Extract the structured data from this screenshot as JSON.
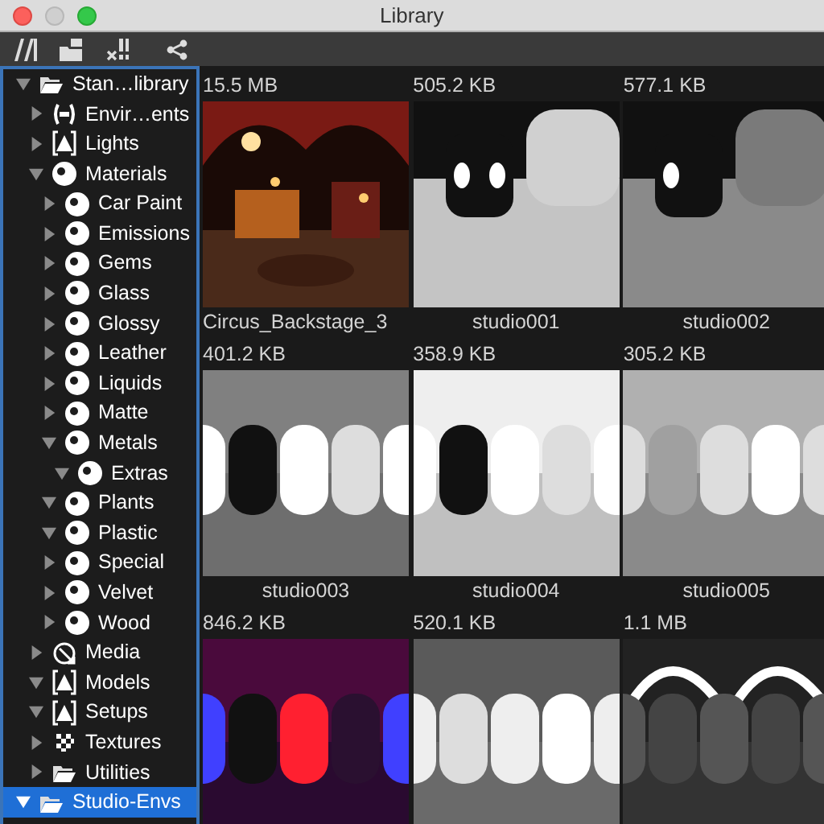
{
  "window": {
    "title": "Library"
  },
  "tree": [
    {
      "label": "Stan…library",
      "kind": "folder",
      "expanded": true,
      "selected": false,
      "children": [
        {
          "label": "Envir…ents",
          "kind": "environment",
          "expanded": false,
          "selected": false
        },
        {
          "label": "Lights",
          "kind": "light",
          "expanded": false,
          "selected": false
        },
        {
          "label": "Materials",
          "kind": "material",
          "expanded": true,
          "selected": false,
          "children": [
            {
              "label": "Car Paint",
              "kind": "material",
              "expanded": false,
              "selected": false
            },
            {
              "label": "Emissions",
              "kind": "material",
              "expanded": false,
              "selected": false
            },
            {
              "label": "Gems",
              "kind": "material",
              "expanded": false,
              "selected": false
            },
            {
              "label": "Glass",
              "kind": "material",
              "expanded": false,
              "selected": false
            },
            {
              "label": "Glossy",
              "kind": "material",
              "expanded": false,
              "selected": false
            },
            {
              "label": "Leather",
              "kind": "material",
              "expanded": false,
              "selected": false
            },
            {
              "label": "Liquids",
              "kind": "material",
              "expanded": false,
              "selected": false
            },
            {
              "label": "Matte",
              "kind": "material",
              "expanded": false,
              "selected": false
            },
            {
              "label": "Metals",
              "kind": "material",
              "expanded": true,
              "selected": false,
              "children": [
                {
                  "label": "Extras",
                  "kind": "material",
                  "expanded": true,
                  "selected": false
                }
              ]
            },
            {
              "label": "Plants",
              "kind": "material",
              "expanded": true,
              "selected": false
            },
            {
              "label": "Plastic",
              "kind": "material",
              "expanded": true,
              "selected": false
            },
            {
              "label": "Special",
              "kind": "material",
              "expanded": false,
              "selected": false
            },
            {
              "label": "Velvet",
              "kind": "material",
              "expanded": false,
              "selected": false
            },
            {
              "label": "Wood",
              "kind": "material",
              "expanded": false,
              "selected": false
            }
          ]
        },
        {
          "label": "Media",
          "kind": "media",
          "expanded": false,
          "selected": false
        },
        {
          "label": "Models",
          "kind": "light",
          "expanded": true,
          "selected": false
        },
        {
          "label": "Setups",
          "kind": "light",
          "expanded": true,
          "selected": false
        },
        {
          "label": "Textures",
          "kind": "texture",
          "expanded": false,
          "selected": false
        },
        {
          "label": "Utilities",
          "kind": "folder",
          "expanded": false,
          "selected": false
        }
      ]
    },
    {
      "label": "Studio-Envs",
      "kind": "folder",
      "expanded": true,
      "selected": true
    }
  ],
  "items": [
    {
      "size": "15.5 MB",
      "name": "Circus_Backstage_3",
      "kind": "picture"
    },
    {
      "size": "505.2 KB",
      "name": "studio001",
      "kind": "picture"
    },
    {
      "size": "577.1 KB",
      "name": "studio002",
      "kind": "picture"
    },
    {
      "size": "401.2 KB",
      "name": "studio003",
      "kind": "picture"
    },
    {
      "size": "358.9 KB",
      "name": "studio004",
      "kind": "picture"
    },
    {
      "size": "305.2 KB",
      "name": "studio005",
      "kind": "picture"
    },
    {
      "size": "846.2 KB",
      "kind": "picture"
    },
    {
      "size": "520.1 KB",
      "kind": "picture"
    },
    {
      "size": "1.1 MB",
      "kind": "picture"
    }
  ]
}
